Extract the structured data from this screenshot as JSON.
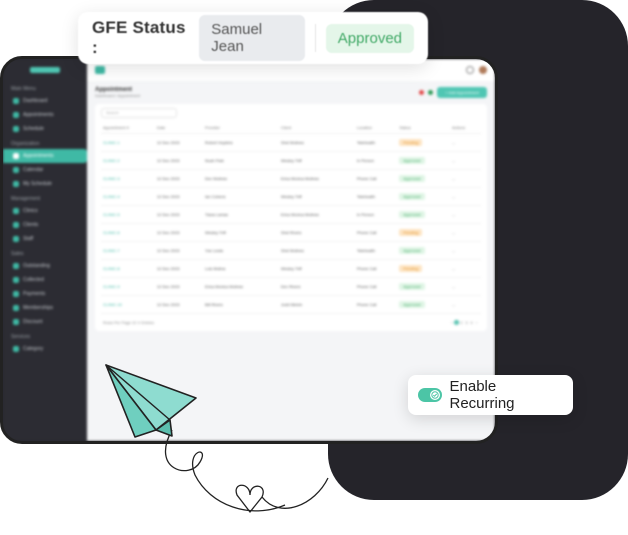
{
  "status_card": {
    "label": "GFE Status :",
    "name": "Samuel Jean",
    "badge": "Approved"
  },
  "sidebar": {
    "groups": [
      {
        "title": "Main Menu",
        "items": [
          "Dashboard",
          "Appointments",
          "Schedule"
        ]
      },
      {
        "title": "Organization",
        "items": [
          "Appointments",
          "Calendar",
          "My Schedule"
        ]
      },
      {
        "title": "Management",
        "items": [
          "Clinics",
          "Clients",
          "Staff"
        ]
      },
      {
        "title": "Sales",
        "items": [
          "Outstanding",
          "Collected",
          "Payments",
          "Memberships",
          "Discount"
        ]
      },
      {
        "title": "Services",
        "items": [
          "Category"
        ]
      }
    ]
  },
  "page": {
    "title": "Appointment",
    "crumb": "Dashboard / Appointment",
    "add_button": "+ Add Appointment",
    "search_placeholder": "Search"
  },
  "table": {
    "headers": [
      "Appointment #",
      "Date",
      "Provider",
      "Client",
      "Location",
      "Status",
      "Actions"
    ],
    "rows": [
      [
        "CLINIC-1",
        "12 Dec 2023",
        "Robert Hopkins",
        "Shei Molines",
        "Telehealth",
        "Pending",
        "..."
      ],
      [
        "CLINIC-2",
        "12 Dec 2023",
        "Noah Park",
        "Wesley Triff",
        "In Person",
        "Approved",
        "..."
      ],
      [
        "CLINIC-3",
        "12 Dec 2023",
        "Dev Molines",
        "Erica Monica Molines",
        "Phone Call",
        "Approved",
        "..."
      ],
      [
        "CLINIC-4",
        "12 Dec 2023",
        "Ian Cohens",
        "Wesley Triff",
        "Telehealth",
        "Approved",
        "..."
      ],
      [
        "CLINIC-5",
        "12 Dec 2023",
        "Tiana Lamas",
        "Erica Monica Molines",
        "In Person",
        "Approved",
        "..."
      ],
      [
        "CLINIC-6",
        "12 Dec 2023",
        "Wesley Triff",
        "Shei Rivers",
        "Phone Call",
        "Pending",
        "..."
      ],
      [
        "CLINIC-7",
        "12 Dec 2023",
        "Yoe Lewis",
        "Shei Molines",
        "Telehealth",
        "Approved",
        "..."
      ],
      [
        "CLINIC-8",
        "12 Dec 2023",
        "Luis Molina",
        "Wesley Triff",
        "Phone Call",
        "Pending",
        "..."
      ],
      [
        "CLINIC-9",
        "12 Dec 2023",
        "Erica Monica Molines",
        "Dev Rivers",
        "Phone Call",
        "Approved",
        "..."
      ],
      [
        "CLINIC-10",
        "12 Dec 2023",
        "Bill Rivers",
        "Judd Melvin",
        "Phone Call",
        "Approved",
        "..."
      ]
    ],
    "footer_left": "Rows Per Page 10 ∨ Entries",
    "pages": [
      "‹",
      "1",
      "2",
      "3",
      "4",
      "›"
    ]
  },
  "recurring": {
    "label": "Enable Recurring",
    "enabled": true
  },
  "colors": {
    "accent": "#4cc5a6",
    "dark": "#25242a"
  }
}
